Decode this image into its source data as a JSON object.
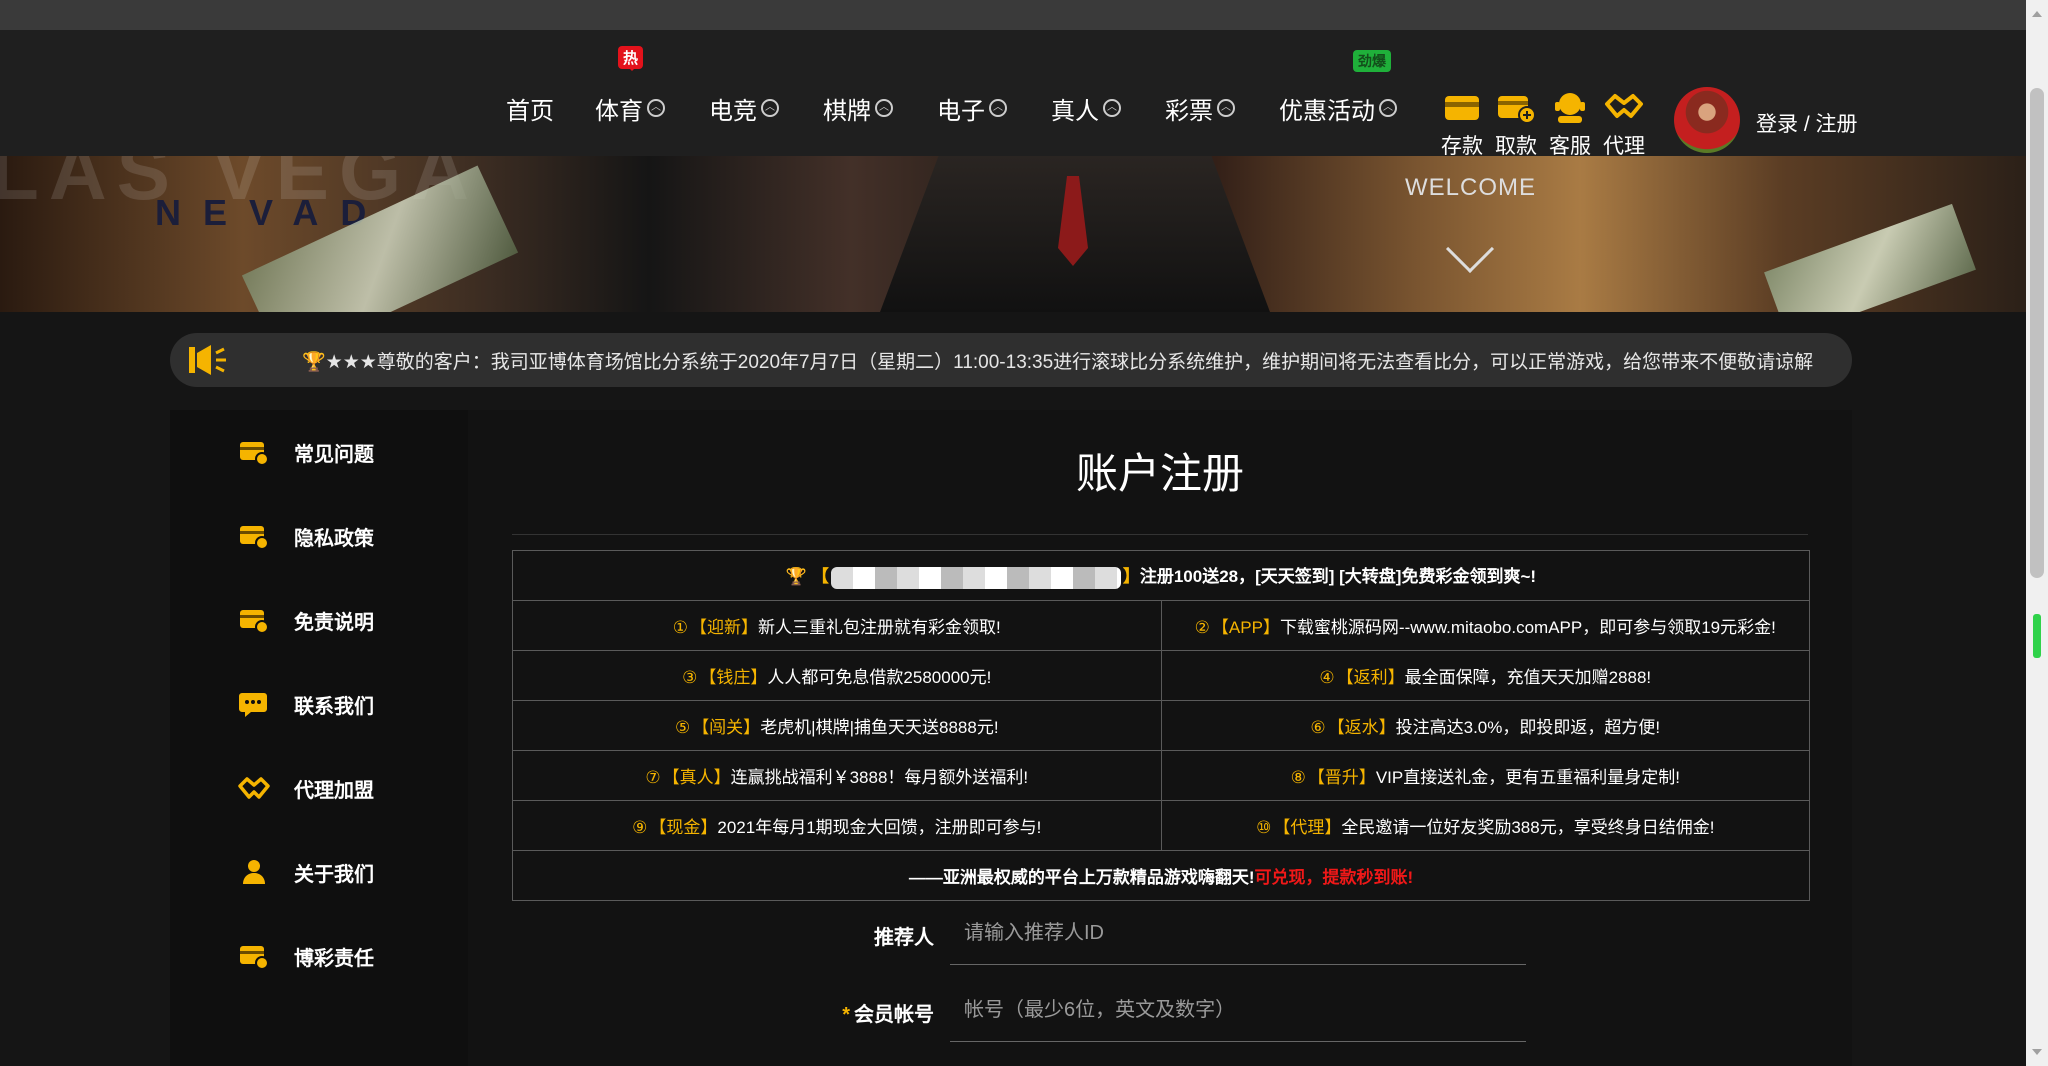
{
  "nav": {
    "items": [
      {
        "label": "首页",
        "dropdown": false
      },
      {
        "label": "体育",
        "dropdown": true,
        "badge": "热"
      },
      {
        "label": "电竞",
        "dropdown": true
      },
      {
        "label": "棋牌",
        "dropdown": true
      },
      {
        "label": "电子",
        "dropdown": true
      },
      {
        "label": "真人",
        "dropdown": true
      },
      {
        "label": "彩票",
        "dropdown": true
      },
      {
        "label": "优惠活动",
        "dropdown": true,
        "badge": "劲爆"
      }
    ],
    "chevron_glyph": "︿",
    "utilities": [
      {
        "label": "存款",
        "icon": "wallet-icon"
      },
      {
        "label": "取款",
        "icon": "withdraw-icon"
      },
      {
        "label": "客服",
        "icon": "headset-icon"
      },
      {
        "label": "代理",
        "icon": "handshake-icon"
      }
    ],
    "login_label": "登录 / 注册"
  },
  "banner": {
    "bg_text": "LAS VEGA",
    "nevada": "NEVAD",
    "welcome": "WELCOME"
  },
  "notice": {
    "text": "★★★尊敬的客户：我司亚博体育场馆比分系统于2020年7月7日（星期二）11:00-13:35进行滚球比分系统维护，维护期间将无法查看比分，可以正常游戏，给您带来不便敬请谅解"
  },
  "sidebar": {
    "items": [
      {
        "label": "常见问题",
        "icon": "card-icon"
      },
      {
        "label": "隐私政策",
        "icon": "card-icon"
      },
      {
        "label": "免责说明",
        "icon": "card-icon"
      },
      {
        "label": "联系我们",
        "icon": "chat-icon"
      },
      {
        "label": "代理加盟",
        "icon": "handshake-icon"
      },
      {
        "label": "关于我们",
        "icon": "user-icon"
      },
      {
        "label": "博彩责任",
        "icon": "card-icon"
      }
    ]
  },
  "main": {
    "title": "账户注册",
    "promo": {
      "head_open": "【",
      "head_close": "】",
      "head_text": "注册100送28，[天天签到] [大转盘]免费彩金领到爽~!",
      "rows": [
        [
          {
            "num": "①",
            "tag": "【迎新】",
            "text": "新人三重礼包注册就有彩金领取!"
          },
          {
            "num": "②",
            "tag": "【APP】",
            "text": "下载蜜桃源码网--www.mitaobo.comAPP，即可参与领取19元彩金!"
          }
        ],
        [
          {
            "num": "③",
            "tag": "【钱庄】",
            "text": "人人都可免息借款2580000元!"
          },
          {
            "num": "④",
            "tag": "【返利】",
            "text": "最全面保障，充值天天加赠2888!"
          }
        ],
        [
          {
            "num": "⑤",
            "tag": "【闯关】",
            "text": "老虎机|棋牌|捕鱼天天送8888元!"
          },
          {
            "num": "⑥",
            "tag": "【返水】",
            "text": "投注高达3.0%，即投即返，超方便!"
          }
        ],
        [
          {
            "num": "⑦",
            "tag": "【真人】",
            "text": "连赢挑战福利￥3888！每月额外送福利!"
          },
          {
            "num": "⑧",
            "tag": "【晋升】",
            "text": "VIP直接送礼金，更有五重福利量身定制!"
          }
        ],
        [
          {
            "num": "⑨",
            "tag": "【现金】",
            "text": "2021年每月1期现金大回馈，注册即可参与!"
          },
          {
            "num": "⑩",
            "tag": "【代理】",
            "text": "全民邀请一位好友奖励388元，享受终身日结佣金!"
          }
        ]
      ],
      "footer_white": "——亚洲最权威的平台上万款精品游戏嗨翻天!",
      "footer_red": "可兑现，提款秒到账!"
    },
    "fields": [
      {
        "label": "推荐人",
        "required": false,
        "placeholder": "请输入推荐人ID"
      },
      {
        "label": "会员帐号",
        "required": true,
        "placeholder": "帐号（最少6位，英文及数字）"
      }
    ],
    "required_mark": "*"
  },
  "colors": {
    "accent": "#f5b400",
    "hot_badge": "#e3121b",
    "promo_badge": "#1fb03a",
    "warning_text": "#f01818",
    "header_bg": "#1f1f1f"
  }
}
